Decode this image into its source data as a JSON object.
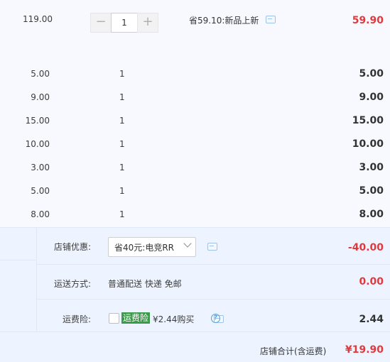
{
  "top_item": {
    "unit_price": "119.00",
    "quantity": "1",
    "minus": "−",
    "plus": "+",
    "promo": "省59.10:新品上新",
    "subtotal": "59.90"
  },
  "items": [
    {
      "price": "5.00",
      "qty": "1",
      "subtotal": "5.00"
    },
    {
      "price": "9.00",
      "qty": "1",
      "subtotal": "9.00"
    },
    {
      "price": "15.00",
      "qty": "1",
      "subtotal": "15.00"
    },
    {
      "price": "10.00",
      "qty": "1",
      "subtotal": "10.00"
    },
    {
      "price": "3.00",
      "qty": "1",
      "subtotal": "3.00"
    },
    {
      "price": "5.00",
      "qty": "1",
      "subtotal": "5.00"
    },
    {
      "price": "8.00",
      "qty": "1",
      "subtotal": "8.00"
    }
  ],
  "summary": {
    "store_discount_label": "店铺优惠:",
    "store_discount_select": "省40元:电竞RR",
    "store_discount_value": "-40.00",
    "shipping_label": "运送方式:",
    "shipping_value_text": "普通配送 快递 免邮",
    "shipping_value": "0.00",
    "insurance_label": "运费险:",
    "insurance_badge": "运费险",
    "insurance_text": "¥2.44购买",
    "insurance_help": "?",
    "insurance_value": "2.44",
    "total_label": "店铺合计(含运费)",
    "total_value": "¥19.90"
  },
  "icons": {
    "chat": "chat-bubble-icon",
    "help": "help-circle-icon",
    "chevron": "chevron-down-icon"
  },
  "colors": {
    "price_red": "#e4393c",
    "badge_green": "#3a9b49",
    "summary_bg": "#eef4ff"
  }
}
